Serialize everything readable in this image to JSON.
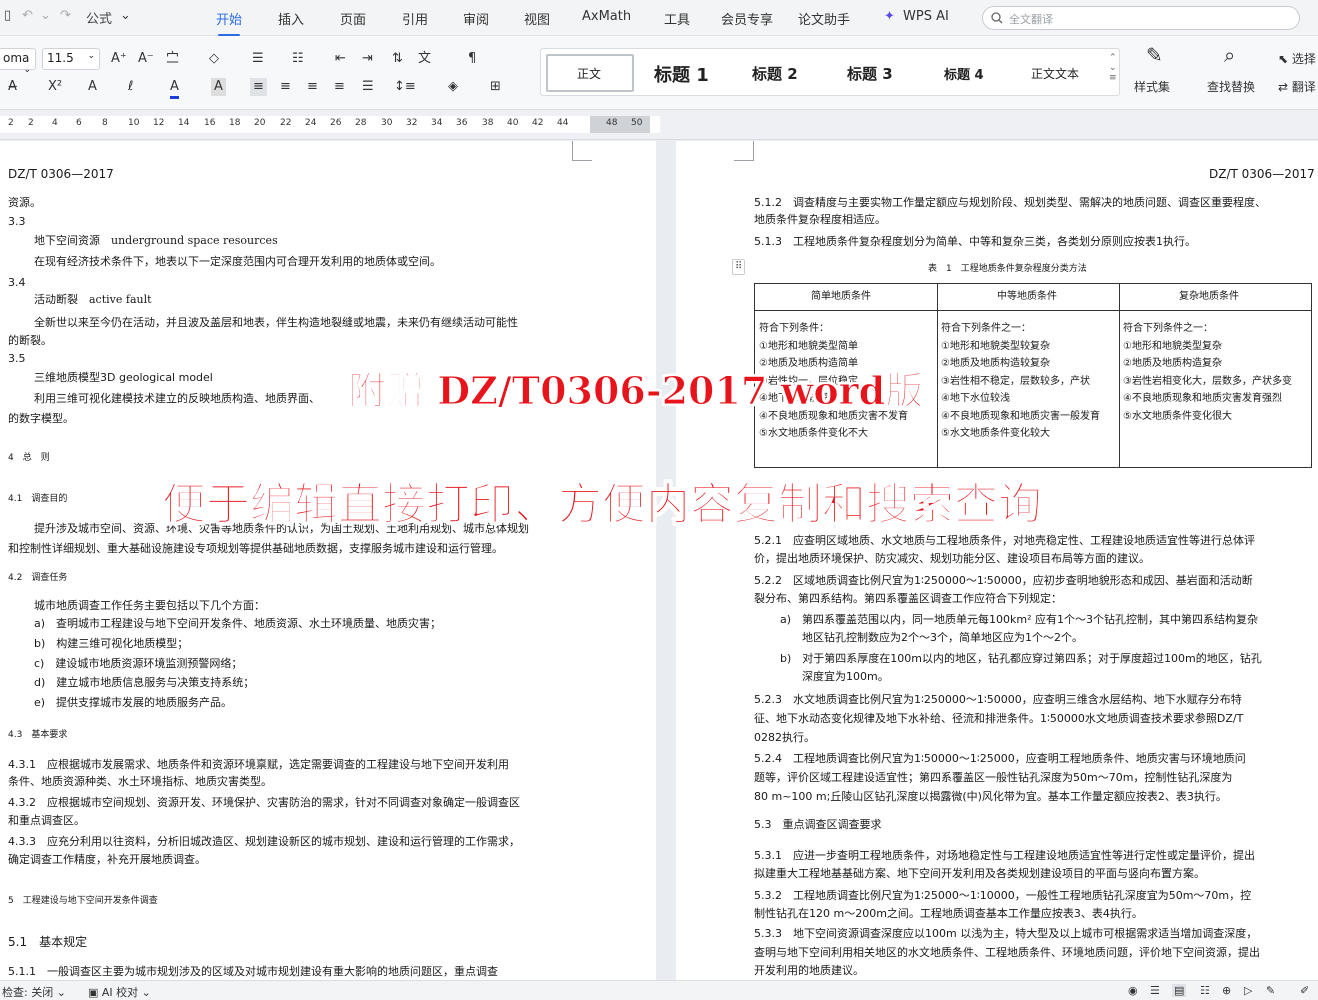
{
  "menubar": {
    "format_painter_label": "公式",
    "tabs": [
      "开始",
      "插入",
      "页面",
      "引用",
      "审阅",
      "视图",
      "AxMath",
      "工具",
      "会员专享",
      "论文助手",
      "WPS AI"
    ],
    "active_tab": "开始",
    "search_placeholder": "全文翻译"
  },
  "ribbon": {
    "font_name": "oma",
    "font_size": "11.5",
    "styles": [
      "正文",
      "标题 1",
      "标题 2",
      "标题 3",
      "标题 4",
      "正文文本"
    ],
    "style_set_label": "样式集",
    "find_replace_label": "查找替换",
    "select_label": "选择",
    "translate_label": "翻译"
  },
  "ruler": {
    "ticks": [
      "2",
      "2",
      "4",
      "6",
      "8",
      "10",
      "12",
      "14",
      "16",
      "18",
      "20",
      "22",
      "24",
      "26",
      "28",
      "30",
      "32",
      "34",
      "36",
      "38",
      "40",
      "42",
      "44",
      "48",
      "50"
    ]
  },
  "left_page": {
    "header": "DZ/T 0306—2017",
    "lines": [
      "资源。",
      "3.3",
      "地下空间资源　underground space resources",
      "在现有经济技术条件下，地表以下一定深度范围内可合理开发利用的地质体或空间。",
      "3.4",
      "活动断裂　active fault",
      "全新世以来至今仍在活动，并且波及盖层和地表，伴生构造地裂缝或地震，未来仍有继续活动可能性",
      "的断裂。",
      "3.5",
      "三维地质模型3D geological model",
      "利用三维可视化建模技术建立的反映地质构造、地质界面、",
      "的数字模型。",
      "4　总　则",
      "4.1　调查目的",
      "提升涉及城市空间、资源、环境、灾害等地质条件的认识，为国土规划、土地利用规划、城市总体规划",
      "和控制性详细规划、重大基础设施建设专项规划等提供基础地质数据，支撑服务城市建设和运行管理。",
      "4.2　调查任务",
      "城市地质调查工作任务主要包括以下几个方面：",
      "a)　查明城市工程建设与地下空间开发条件、地质资源、水土环境质量、地质灾害；",
      "b)　构建三维可视化地质模型；",
      "c)　建设城市地质资源环境监测预警网络；",
      "d)　建立城市地质信息服务与决策支持系统；",
      "e)　提供支撑城市发展的地质服务产品。",
      "4.3　基本要求",
      "4.3.1　应根据城市发展需求、地质条件和资源环境禀赋，选定需要调查的工程建设与地下空间开发利用",
      "条件、地质资源种类、水土环境指标、地质灾害类型。",
      "4.3.2　应根据城市空间规划、资源开发、环境保护、灾害防治的需求，针对不同调查对象确定一般调查区",
      "和重点调查区。",
      "4.3.3　应充分利用以往资料，分析旧城改造区、规划建设新区的城市规划、建设和运行管理的工作需求，",
      "确定调查工作精度，补充开展地质调查。",
      "5　工程建设与地下空间开发条件调查",
      "5.1　基本规定",
      "5.1.1　一般调查区主要为城市规划涉及的区域及对城市规划建设有重大影响的地质问题区，重点调查"
    ]
  },
  "right_page": {
    "header": "DZ/T 0306—2017",
    "lines_top": [
      "5.1.2　调查精度与主要实物工作量定额应与规划阶段、规划类型、需解决的地质问题、调查区重要程度、",
      "地质条件复杂程度相适应。",
      "5.1.3　工程地质条件复杂程度划分为简单、中等和复杂三类，各类划分原则应按表1执行。"
    ],
    "table_caption": "表　1　工程地质条件复杂程度分类方法",
    "table_headers": [
      "简单地质条件",
      "中等地质条件",
      "复杂地质条件"
    ],
    "table_rows": [
      [
        "符合下列条件：",
        "符合下列条件之一：",
        "符合下列条件之一："
      ],
      [
        "①地形和地貌类型简单",
        "①地形和地貌类型较复杂",
        "①地形和地貌类型复杂"
      ],
      [
        "②地质及地质构造简单",
        "②地质及地质构造较复杂",
        "②地质及地质构造复杂"
      ],
      [
        "③岩性均一，层位稳定",
        "③岩性相不稳定，层数较多，产状",
        "③岩性岩相变化大，层数多，产状多变"
      ],
      [
        "④地下水位较深",
        "④地下水位较浅",
        "④不良地质现象和地质灾害发育强烈"
      ],
      [
        "④不良地质现象和地质灾害不发育",
        "④不良地质现象和地质灾害一般发育",
        "⑤水文地质条件变化很大"
      ],
      [
        "⑤水文地质条件变化不大",
        "⑤水文地质条件变化较大",
        ""
      ]
    ],
    "lines_bottom": [
      "5.2.1　应查明区域地质、水文地质与工程地质条件，对地壳稳定性、工程建设地质适宜性等进行总体评",
      "价，提出地质环境保护、防灾减灾、规划功能分区、建设项目布局等方面的建议。",
      "5.2.2　区域地质调查比例尺宜为1∶250000～1∶50000，应初步查明地貌形态和成因、基岩面和活动断",
      "裂分布、第四系结构。第四系覆盖区调查工作应符合下列规定：",
      "a)　第四系覆盖范围以内，同一地质单元每100km² 应有1个～3个钻孔控制，其中第四系结构复杂",
      "地区钻孔控制数应为2个～3个，简单地区应为1个～2个。",
      "b)　对于第四系厚度在100m以内的地区，钻孔都应穿过第四系；对于厚度超过100m的地区，钻孔",
      "深度宜为100m。",
      "5.2.3　水文地质调查比例尺宜为1∶250000～1∶50000，应查明三维含水层结构、地下水赋存分布特",
      "征、地下水动态变化规律及地下水补给、径流和排泄条件。1∶50000水文地质调查技术要求参照DZ/T",
      "0282执行。",
      "5.2.4　工程地质调查比例尺宜为1∶50000～1∶25000，应查明工程地质条件、地质灾害与环境地质问",
      "题等，评价区域工程建设适宜性；第四系覆盖区一般性钻孔深度为50m～70m，控制性钻孔深度为",
      "80 m~100 m;丘陵山区钻孔深度以揭露微(中)风化带为宜。基本工作量定额应按表2、表3执行。",
      "5.3　重点调查区调查要求",
      "5.3.1　应进一步查明工程地质条件，对场地稳定性与工程建设地质适宜性等进行定性或定量评价，提出",
      "拟建重大工程地基基础方案、地下空间开发利用及各类规划建设项目的平面与竖向布置方案。",
      "5.3.2　工程地质调查比例尺宜为1∶25000～1∶10000，一般性工程地质钻孔深度宜为50m～70m，控",
      "制性钻孔在120 m～200m之间。工程地质调查基本工作量应按表3、表4执行。",
      "5.3.3　地下空间资源调查深度应以100m 以浅为主，特大型及以上城市可根据需求适当增加调查深度，",
      "查明与地下空间利用相关地区的水文地质条件、工程地质条件、环境地质问题，评价地下空间资源，提出",
      "开发利用的地质建议。"
    ]
  },
  "overlay": {
    "line1": "附赠 DZ/T0306-2017 word版",
    "line2": "便于编辑直接打印、方便内容复制和搜索查询"
  },
  "statusbar": {
    "spellcheck": "检查: 关闭",
    "ai_check": "AI 校对"
  },
  "colors": {
    "accent": "#2b6be6",
    "banner": "#e8141c"
  }
}
